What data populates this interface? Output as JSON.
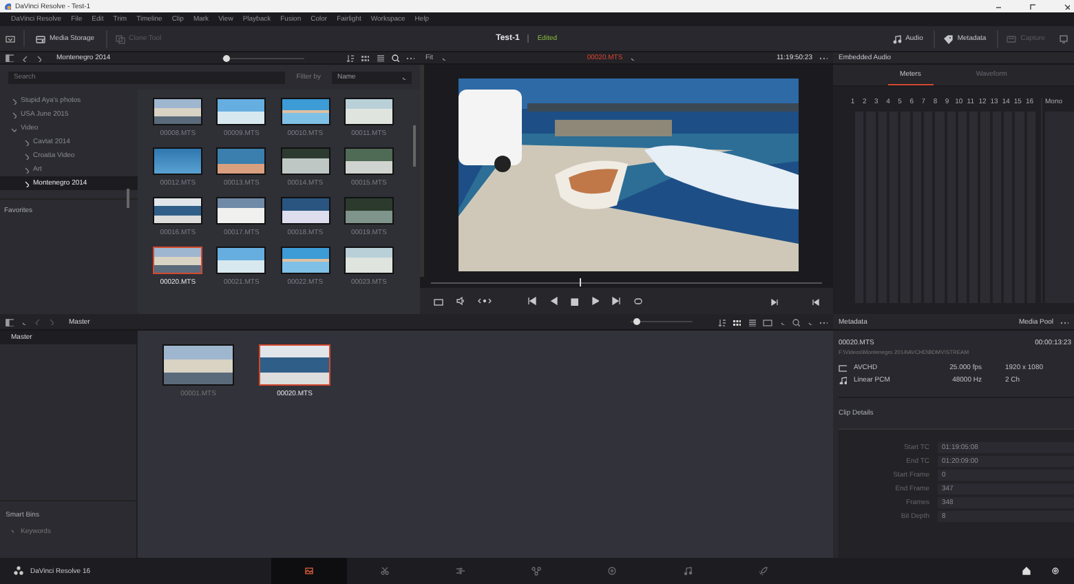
{
  "window": {
    "title": "DaVinci Resolve - Test-1"
  },
  "menu": [
    "DaVinci Resolve",
    "File",
    "Edit",
    "Trim",
    "Timeline",
    "Clip",
    "Mark",
    "View",
    "Playback",
    "Fusion",
    "Color",
    "Fairlight",
    "Workspace",
    "Help"
  ],
  "toolbar": {
    "left": [
      {
        "kind": "storage",
        "label": "Media Storage",
        "disabled": false
      },
      {
        "kind": "clone",
        "label": "Clone Tool",
        "disabled": true
      }
    ],
    "project": "Test-1",
    "project_status": "Edited",
    "right": [
      {
        "kind": "audio",
        "label": "Audio",
        "disabled": false
      },
      {
        "kind": "metadata",
        "label": "Metadata",
        "disabled": false
      },
      {
        "kind": "capture",
        "label": "Capture",
        "disabled": true
      }
    ]
  },
  "media_storage": {
    "location": "Montenegro 2014",
    "thumb_size": {
      "level": 0.05
    },
    "search": {
      "placeholder": "Search"
    },
    "filter_label": "Filter by",
    "filter_value": "Name",
    "tree": [
      {
        "label": "Stupid Aya's photos",
        "expanded": false,
        "selected": false
      },
      {
        "label": "USA June 2015",
        "expanded": false,
        "selected": false
      },
      {
        "label": "Video",
        "expanded": true,
        "selected": false,
        "children": [
          {
            "label": "Cavtat 2014",
            "expanded": false,
            "selected": false
          },
          {
            "label": "Croatia Video",
            "expanded": false,
            "selected": false
          },
          {
            "label": "Art",
            "expanded": false,
            "selected": false
          },
          {
            "label": "Montenegro 2014",
            "expanded": false,
            "selected": true
          }
        ]
      }
    ],
    "favorites": "Favorites",
    "clips": [
      {
        "name": "00008.MTS",
        "selected": false
      },
      {
        "name": "00009.MTS",
        "selected": false
      },
      {
        "name": "00010.MTS",
        "selected": false
      },
      {
        "name": "00011.MTS",
        "selected": false
      },
      {
        "name": "00012.MTS",
        "selected": false
      },
      {
        "name": "00013.MTS",
        "selected": false
      },
      {
        "name": "00014.MTS",
        "selected": false
      },
      {
        "name": "00015.MTS",
        "selected": false
      },
      {
        "name": "00016.MTS",
        "selected": false
      },
      {
        "name": "00017.MTS",
        "selected": false
      },
      {
        "name": "00018.MTS",
        "selected": false
      },
      {
        "name": "00019.MTS",
        "selected": false
      },
      {
        "name": "00020.MTS",
        "selected": true
      },
      {
        "name": "00021.MTS",
        "selected": false
      },
      {
        "name": "00022.MTS",
        "selected": false
      },
      {
        "name": "00023.MTS",
        "selected": false
      }
    ]
  },
  "viewer": {
    "zoom": "Fit",
    "clip": "00020.MTS",
    "timecode": "11:19:50:23",
    "playhead": {
      "level": 0.38
    }
  },
  "audio": {
    "title": "Embedded Audio",
    "tabs": [
      {
        "label": "Meters",
        "selected": true
      },
      {
        "label": "Waveform",
        "selected": false
      }
    ],
    "channels": [
      "1",
      "2",
      "3",
      "4",
      "5",
      "6",
      "7",
      "8",
      "9",
      "10",
      "11",
      "12",
      "13",
      "14",
      "15",
      "16"
    ],
    "monitor": "Mono"
  },
  "media_pool": {
    "bin": "Master",
    "zoom": {
      "level": 0.1
    },
    "bins": [
      {
        "label": "Master",
        "selected": true
      }
    ],
    "smart_bins": "Smart Bins",
    "smart_items": [
      {
        "label": "Keywords",
        "expanded": false
      }
    ],
    "clips": [
      {
        "name": "00001.MTS",
        "selected": false
      },
      {
        "name": "00020.MTS",
        "selected": true
      }
    ]
  },
  "metadata": {
    "title": "Metadata",
    "pool_label": "Media Pool",
    "clip": "00020.MTS",
    "duration": "00:00:13:23",
    "path": "F:\\Videos\\Montenegro 2014\\AVCHD\\BDMV\\STREAM",
    "streams": [
      {
        "kind": "video",
        "codec": "AVCHD",
        "rate": "25.000 fps",
        "format": "1920 x 1080"
      },
      {
        "kind": "audio",
        "codec": "Linear PCM",
        "rate": "48000 Hz",
        "format": "2 Ch"
      }
    ],
    "details_title": "Clip Details",
    "details": [
      {
        "label": "Start TC",
        "value": "01:19:05:08"
      },
      {
        "label": "End TC",
        "value": "01:20:09:00"
      },
      {
        "label": "Start Frame",
        "value": "0"
      },
      {
        "label": "End Frame",
        "value": "347"
      },
      {
        "label": "Frames",
        "value": "348"
      },
      {
        "label": "Bit Depth",
        "value": "8"
      }
    ]
  },
  "page_bar": {
    "product": "DaVinci Resolve 16",
    "pages": [
      {
        "kind": "media",
        "selected": true
      },
      {
        "kind": "cut",
        "selected": false
      },
      {
        "kind": "edit",
        "selected": false
      },
      {
        "kind": "fusion",
        "selected": false
      },
      {
        "kind": "color",
        "selected": false
      },
      {
        "kind": "fairlight",
        "selected": false
      },
      {
        "kind": "deliver",
        "selected": false
      }
    ]
  }
}
